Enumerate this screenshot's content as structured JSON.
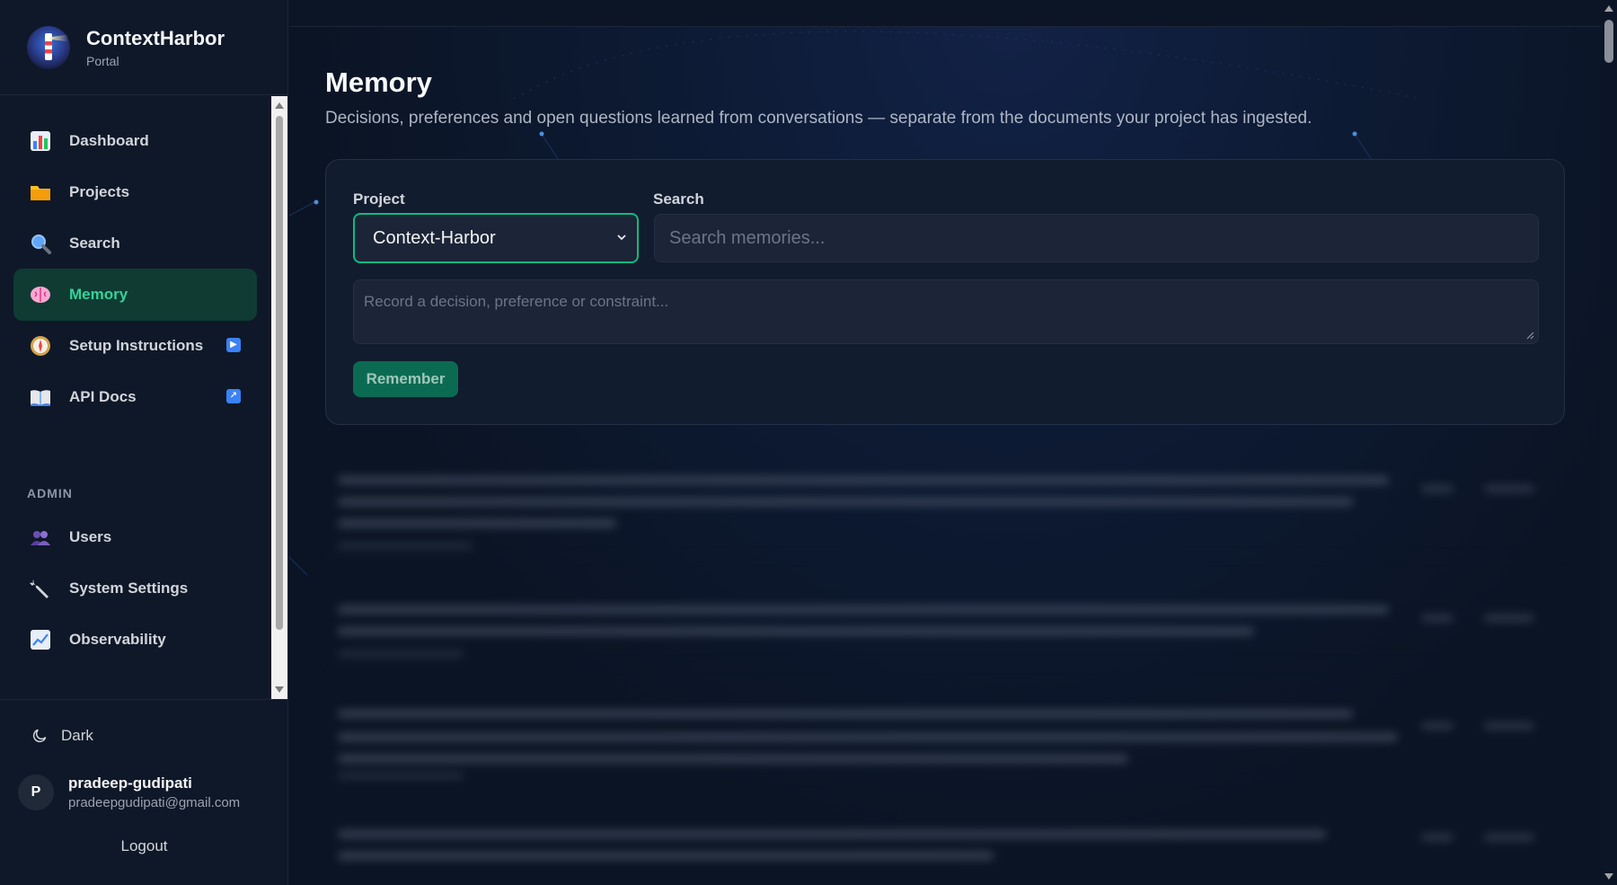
{
  "brand": {
    "title": "ContextHarbor",
    "subtitle": "Portal"
  },
  "nav": {
    "items": [
      {
        "label": "Dashboard",
        "icon": "bar-chart-icon"
      },
      {
        "label": "Projects",
        "icon": "folder-icon"
      },
      {
        "label": "Search",
        "icon": "magnifier-icon"
      },
      {
        "label": "Memory",
        "icon": "brain-icon",
        "active": true
      },
      {
        "label": "Setup Instructions",
        "icon": "compass-icon",
        "badge": "play-icon"
      },
      {
        "label": "API Docs",
        "icon": "book-icon",
        "badge": "external-link-icon"
      }
    ],
    "admin_label": "ADMIN",
    "admin_items": [
      {
        "label": "Users",
        "icon": "users-icon"
      },
      {
        "label": "System Settings",
        "icon": "wrench-icon"
      },
      {
        "label": "Observability",
        "icon": "line-chart-icon"
      }
    ]
  },
  "footer": {
    "theme_label": "Dark",
    "user": {
      "initial": "P",
      "name": "pradeep-gudipati",
      "email": "pradeepgudipati@gmail.com"
    },
    "logout_label": "Logout"
  },
  "page": {
    "title": "Memory",
    "description": "Decisions, preferences and open questions learned from conversations — separate from the documents your project has ingested."
  },
  "form": {
    "project_label": "Project",
    "project_value": "Context-Harbor",
    "search_label": "Search",
    "search_placeholder": "Search memories...",
    "record_placeholder": "Record a decision, preference or constraint...",
    "remember_label": "Remember"
  },
  "colors": {
    "accent": "#10b981",
    "active_nav_bg": "#0f3b33",
    "active_nav_text": "#34d399",
    "button_bg": "#0b6b52"
  }
}
